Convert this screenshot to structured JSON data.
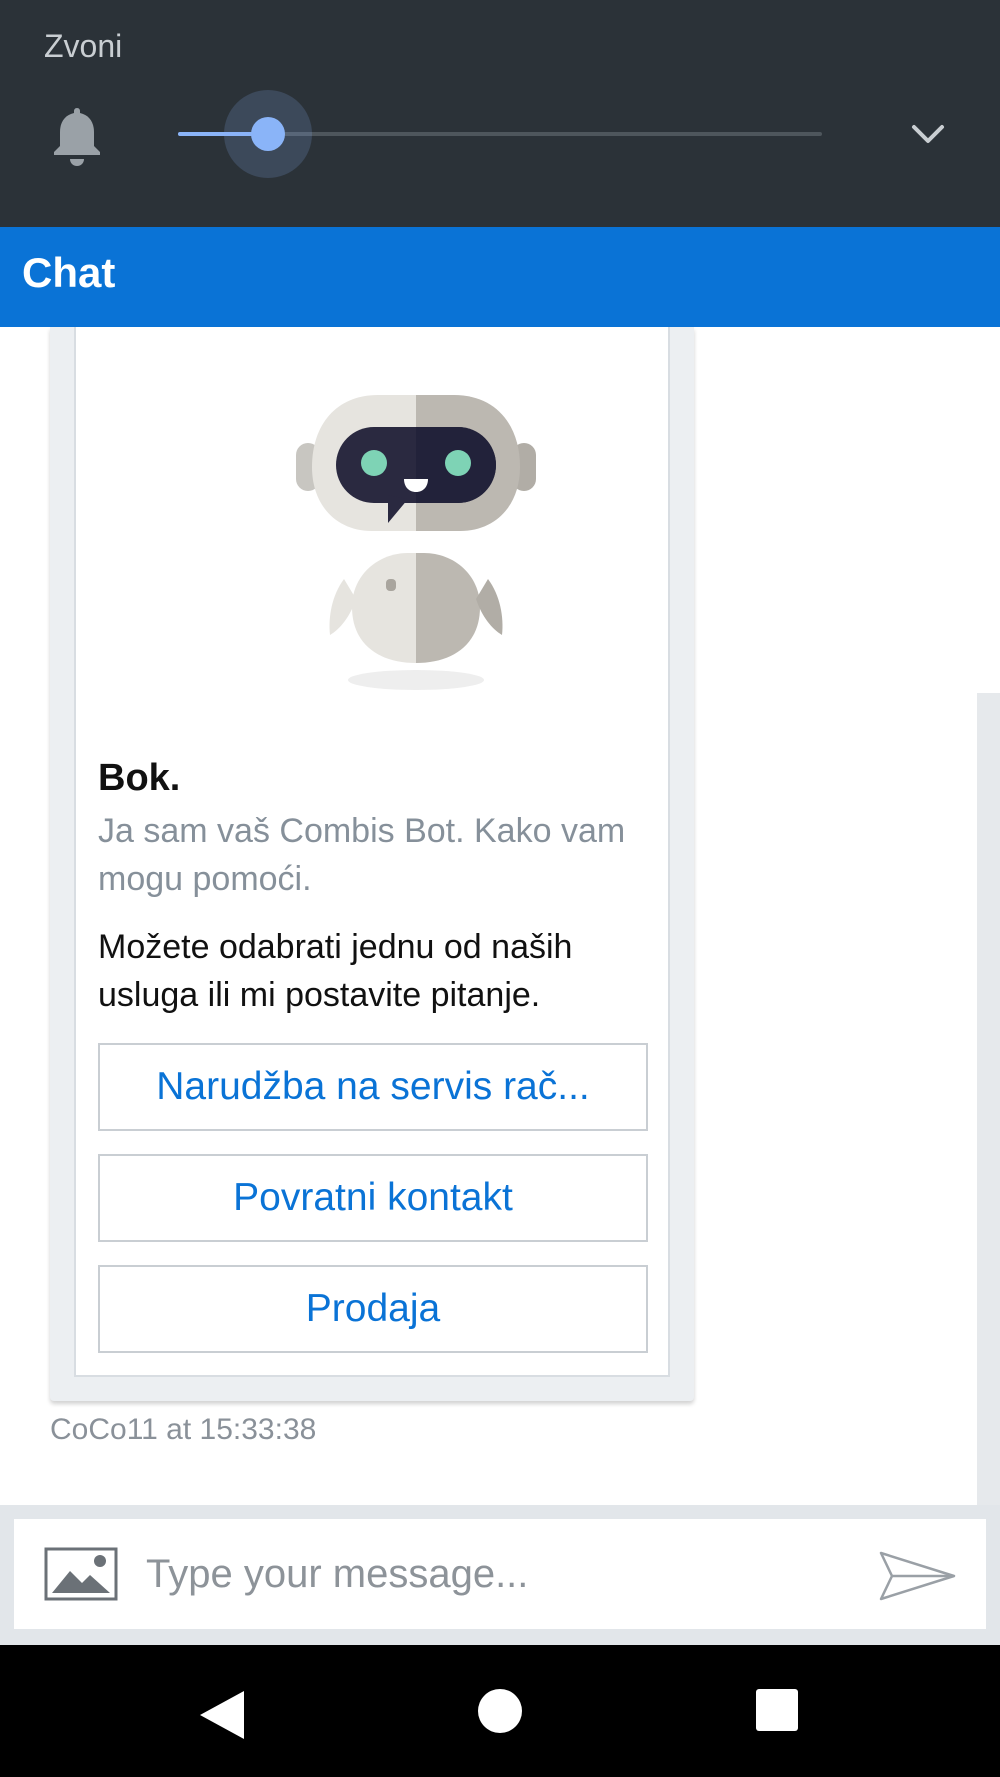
{
  "volume_panel": {
    "title": "Zvoni",
    "level_fraction": 0.14,
    "icons": {
      "ringer": "bell-icon",
      "expand": "chevron-down-icon"
    }
  },
  "app_bar": {
    "title": "Chat"
  },
  "bot_card": {
    "image": "robot-illustration",
    "title": "Bok.",
    "subtitle": "Ja sam vaš Combis Bot. Kako vam mogu pomoći.",
    "body": "Možete odabrati jednu od naših usluga ili mi postavite pitanje.",
    "options": [
      {
        "label": "Narudžba na servis rač..."
      },
      {
        "label": "Povratni kontakt"
      },
      {
        "label": "Prodaja"
      }
    ]
  },
  "message_meta": "CoCo11 at 15:33:38",
  "composer": {
    "placeholder": "Type your message...",
    "icons": {
      "attach": "image-icon",
      "send": "send-icon"
    }
  },
  "nav_bar": {
    "icons": [
      "back-icon",
      "home-icon",
      "recents-icon"
    ]
  },
  "colors": {
    "accent": "#0a73d6",
    "panel": "#2b3238",
    "slider": "#8ab4f8"
  }
}
